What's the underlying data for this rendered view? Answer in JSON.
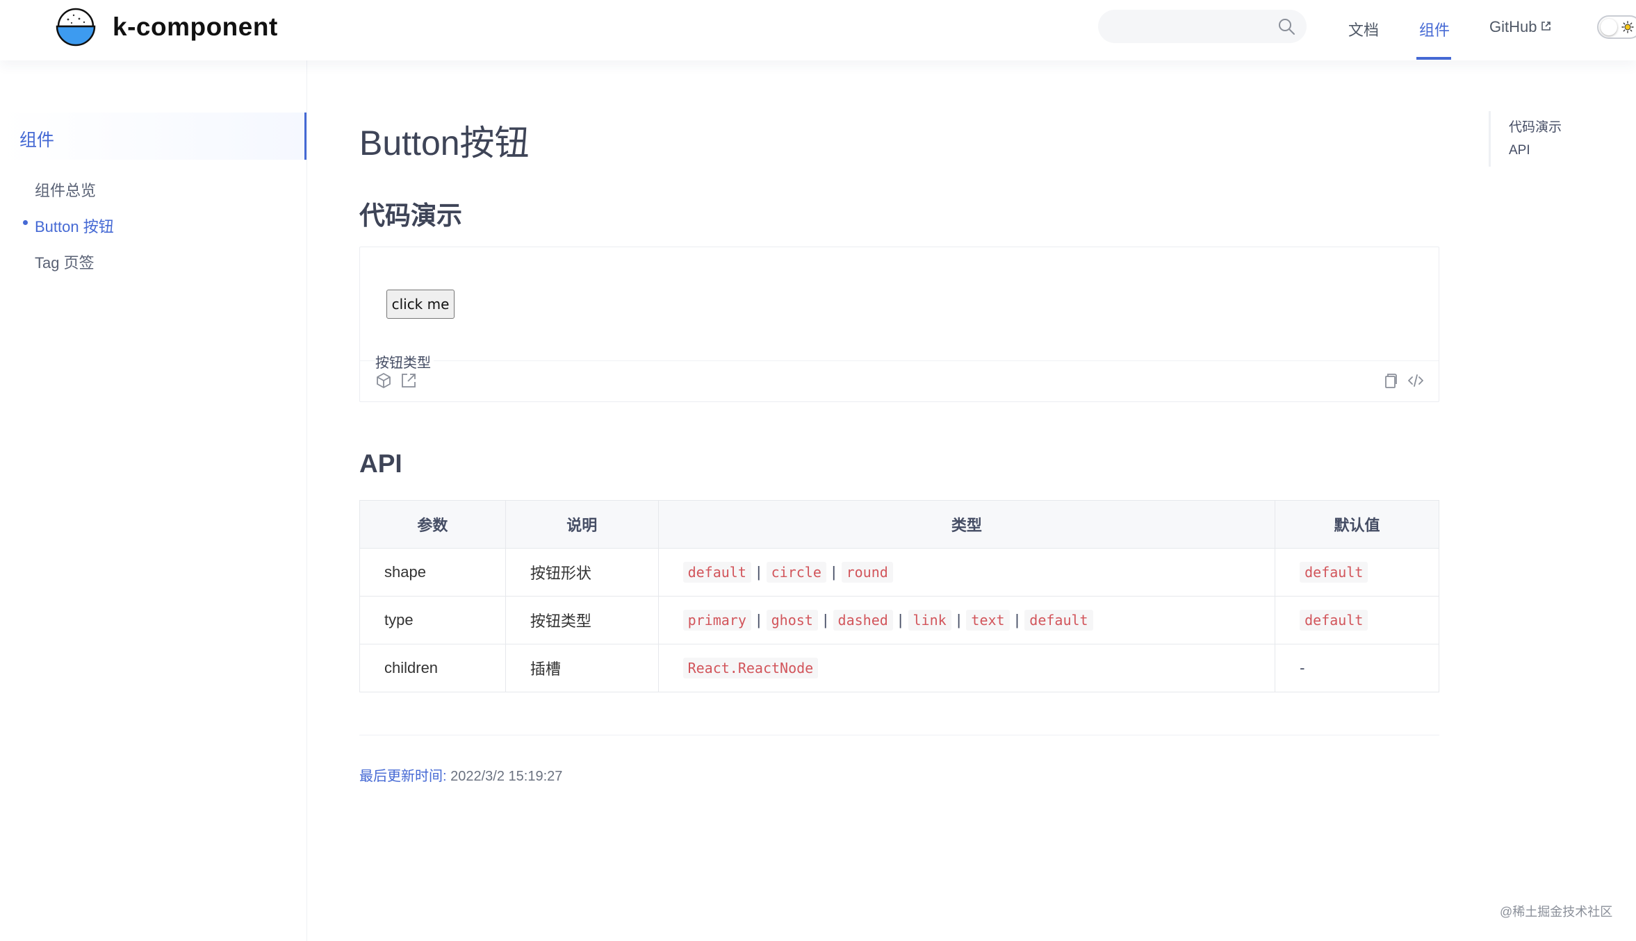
{
  "header": {
    "brand": "k-component",
    "search": {
      "placeholder": ""
    },
    "nav": {
      "docs": "文档",
      "components": "组件",
      "github": "GitHub"
    }
  },
  "sidebar": {
    "group": "组件",
    "items": [
      {
        "label": "组件总览",
        "active": false
      },
      {
        "label": "Button 按钮",
        "active": true
      },
      {
        "label": "Tag 页签",
        "active": false
      }
    ]
  },
  "main": {
    "title": "Button按钮",
    "demo_section": "代码演示",
    "demo": {
      "button_label": "click me",
      "caption": "按钮类型"
    },
    "api_section": "API",
    "table": {
      "headers": [
        "参数",
        "说明",
        "类型",
        "默认值"
      ],
      "rows": [
        {
          "param": "shape",
          "desc": "按钮形状",
          "types": [
            "default",
            "circle",
            "round"
          ],
          "default": "default"
        },
        {
          "param": "type",
          "desc": "按钮类型",
          "types": [
            "primary",
            "ghost",
            "dashed",
            "link",
            "text",
            "default"
          ],
          "default": "default"
        },
        {
          "param": "children",
          "desc": "插槽",
          "types": [
            "React.ReactNode"
          ],
          "default": "-"
        }
      ]
    },
    "updated": {
      "label": "最后更新时间:",
      "time": "2022/3/2 15:19:27"
    }
  },
  "toc": {
    "items": [
      "代码演示",
      "API"
    ]
  },
  "watermark": "@稀土掘金技术社区",
  "colors": {
    "accent": "#4569d4",
    "code": "#d2555b"
  }
}
